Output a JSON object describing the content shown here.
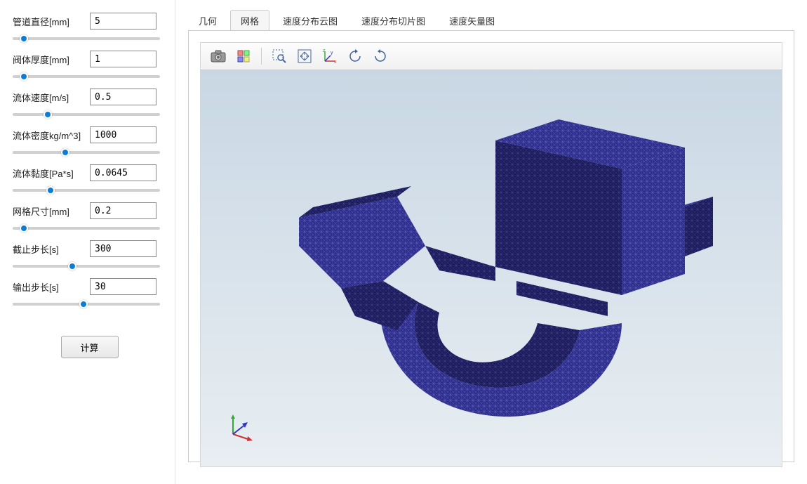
{
  "sidebar": {
    "params": [
      {
        "label": "管道直径[mm]",
        "value": "5",
        "slider": 5
      },
      {
        "label": "阀体厚度[mm]",
        "value": "1",
        "slider": 5
      },
      {
        "label": "流体速度[m/s]",
        "value": "0.5",
        "slider": 22
      },
      {
        "label": "流体密度kg/m^3]",
        "value": "1000",
        "slider": 35
      },
      {
        "label": "流体黏度[Pa*s]",
        "value": "0.0645",
        "slider": 24
      },
      {
        "label": "网格尺寸[mm]",
        "value": "0.2",
        "slider": 5
      },
      {
        "label": "截止步长[s]",
        "value": "300",
        "slider": 40
      },
      {
        "label": "输出步长[s]",
        "value": "30",
        "slider": 48
      }
    ],
    "calc_label": "计算"
  },
  "tabs": [
    {
      "label": "几何",
      "active": false
    },
    {
      "label": "网格",
      "active": true
    },
    {
      "label": "速度分布云图",
      "active": false
    },
    {
      "label": "速度分布切片图",
      "active": false
    },
    {
      "label": "速度矢量图",
      "active": false
    }
  ],
  "toolbar": {
    "items": [
      {
        "name": "snapshot-icon",
        "svg": "camera"
      },
      {
        "name": "print-icon",
        "svg": "grid"
      },
      {
        "name": "divider"
      },
      {
        "name": "zoom-select-icon",
        "svg": "zoom-select"
      },
      {
        "name": "zoom-extents-icon",
        "svg": "zoom-ext"
      },
      {
        "name": "axes-icon",
        "svg": "axes"
      },
      {
        "name": "rotate-ccw-icon",
        "svg": "rot-ccw"
      },
      {
        "name": "rotate-cw-icon",
        "svg": "rot-cw"
      }
    ]
  },
  "visualization": {
    "type": "mesh",
    "mesh_color": "#2c2c8c",
    "background_gradient": [
      "#c9d7e4",
      "#e8eef2"
    ]
  }
}
